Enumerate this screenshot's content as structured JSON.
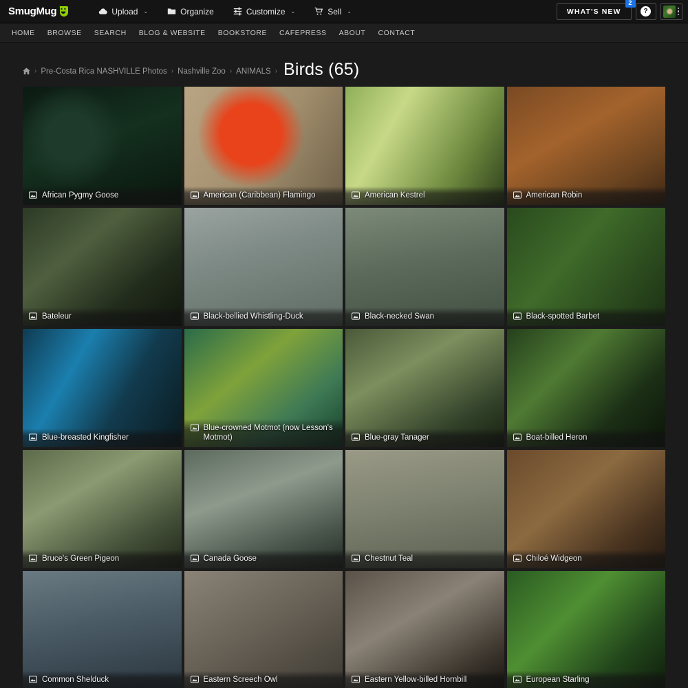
{
  "topbar": {
    "brand": "SmugMug",
    "menu": [
      {
        "label": "Upload",
        "icon": "cloud-upload-icon",
        "caret": "⌄"
      },
      {
        "label": "Organize",
        "icon": "folder-icon",
        "caret": ""
      },
      {
        "label": "Customize",
        "icon": "sliders-icon",
        "caret": "⌄"
      },
      {
        "label": "Sell",
        "icon": "shopping-cart-icon",
        "caret": "⌄"
      }
    ],
    "whats_new_label": "WHAT'S NEW",
    "whats_new_badge": "2",
    "help_glyph": "?",
    "accent_badge_color": "#1a73e8",
    "brand_green": "#8fce00"
  },
  "subnav": {
    "items": [
      "HOME",
      "BROWSE",
      "SEARCH",
      "BLOG & WEBSITE",
      "BOOKSTORE",
      "CAFEPRESS",
      "ABOUT",
      "CONTACT"
    ]
  },
  "breadcrumb": {
    "home_icon": "home-icon",
    "items": [
      "Pre-Costa Rica NASHVILLE Photos",
      "Nashville Zoo",
      "ANIMALS"
    ],
    "separator": "›"
  },
  "page": {
    "title": "Birds (65)"
  },
  "gallery": {
    "caption_icon": "photo-icon",
    "photos": [
      {
        "title": "African Pygmy Goose"
      },
      {
        "title": "American (Caribbean) Flamingo"
      },
      {
        "title": "American Kestrel"
      },
      {
        "title": "American Robin"
      },
      {
        "title": "Bateleur"
      },
      {
        "title": "Black-bellied Whistling-Duck"
      },
      {
        "title": "Black-necked Swan"
      },
      {
        "title": "Black-spotted Barbet"
      },
      {
        "title": "Blue-breasted Kingfisher"
      },
      {
        "title": "Blue-crowned Motmot (now Lesson's Motmot)"
      },
      {
        "title": "Blue-gray Tanager"
      },
      {
        "title": "Boat-billed Heron"
      },
      {
        "title": "Bruce's Green Pigeon"
      },
      {
        "title": "Canada Goose"
      },
      {
        "title": "Chestnut Teal"
      },
      {
        "title": "Chiloé Widgeon"
      },
      {
        "title": "Common Shelduck"
      },
      {
        "title": "Eastern Screech Owl"
      },
      {
        "title": "Eastern Yellow-billed Hornbill"
      },
      {
        "title": "European Starling"
      }
    ]
  }
}
